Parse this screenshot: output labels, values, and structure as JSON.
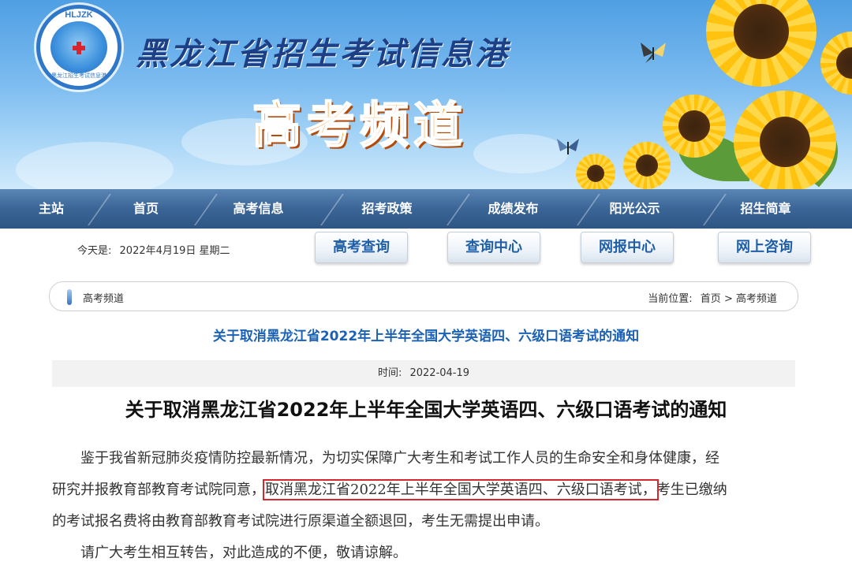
{
  "header": {
    "logo_abbr": "HLJZK",
    "logo_sub": "黑龙江招生考试信息港",
    "site_title": "黑龙江省招生考试信息港",
    "channel_title": "高考频道"
  },
  "nav": {
    "items": [
      {
        "label": "主站"
      },
      {
        "label": "首页"
      },
      {
        "label": "高考信息"
      },
      {
        "label": "招考政策"
      },
      {
        "label": "成绩发布"
      },
      {
        "label": "阳光公示"
      },
      {
        "label": "招生简章"
      }
    ]
  },
  "subbar": {
    "today_label": "今天是:",
    "today_value": "2022年4月19日 星期二",
    "buttons": [
      {
        "label": "高考查询"
      },
      {
        "label": "查询中心"
      },
      {
        "label": "网报中心"
      },
      {
        "label": "网上咨询"
      }
    ]
  },
  "breadcrumb": {
    "channel": "高考频道",
    "location_label": "当前位置:",
    "home": "首页",
    "separator": ">",
    "current": "高考频道"
  },
  "article": {
    "list_title": "关于取消黑龙江省2022年上半年全国大学英语四、六级口语考试的通知",
    "time_label": "时间:",
    "time_value": "2022-04-19",
    "title": "关于取消黑龙江省2022年上半年全国大学英语四、六级口语考试的通知",
    "p1_line1": "鉴于我省新冠肺炎疫情防控最新情况，为切实保障广大考生和考试工作人员的生命安全和身体健康，经",
    "p1_line2_a": "研究并报教育部教育考试院同意，",
    "p1_line2_highlight": "取消黑龙江省2022年上半年全国大学英语四、六级口语考试，",
    "p1_line2_b": "考生已缴纳",
    "p1_line3": "的考试报名费将由教育部教育考试院进行原渠道全额退回，考生无需提出申请。",
    "p2": "请广大考生相互转告，对此造成的不便，敬请谅解。"
  },
  "colors": {
    "nav_bg": "#3a6596",
    "link_blue": "#1c62b4",
    "highlight_red": "#d8262e",
    "channel_orange": "#ff8a12"
  }
}
